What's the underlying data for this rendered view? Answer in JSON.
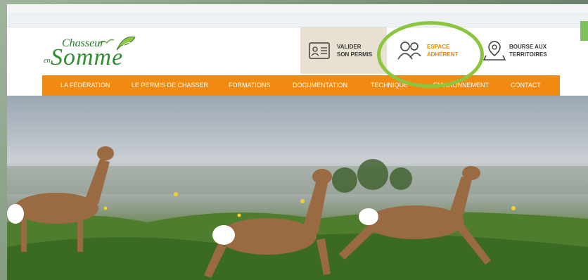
{
  "logo": {
    "line1": "Chasseur",
    "line2": "en",
    "line3": "Somme"
  },
  "header_links": [
    {
      "line1": "VALIDER",
      "line2": "SON PERMIS",
      "icon": "id-card-icon"
    },
    {
      "line1": "ESPACE",
      "line2": "ADHÉRENT",
      "icon": "users-icon"
    },
    {
      "line1": "BOURSE AUX",
      "line2": "TERRITOIRES",
      "icon": "map-pin-icon"
    }
  ],
  "nav": [
    "LA FÉDÉRATION",
    "LE PERMIS DE CHASSER",
    "FORMATIONS",
    "DOCUMENTATION",
    "TECHNIQUE",
    "ENVIRONNEMENT",
    "CONTACT"
  ],
  "colors": {
    "accent": "#f08a10",
    "brand_green": "#2f8f2f",
    "highlight": "#8cc63f"
  }
}
